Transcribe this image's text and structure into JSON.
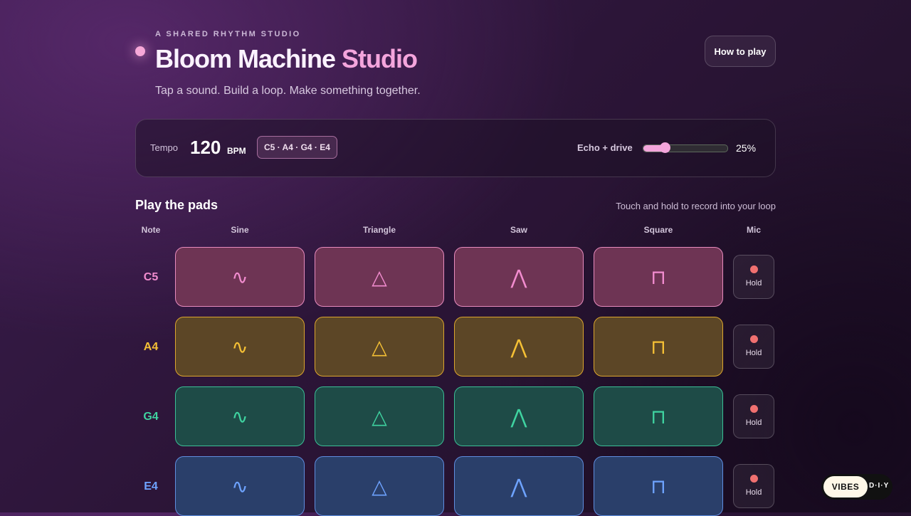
{
  "header": {
    "kicker": "A SHARED RHYTHM STUDIO",
    "title_main": "Bloom Machine",
    "title_accent": "Studio",
    "subtitle": "Tap a sound. Build a loop. Make something together.",
    "how_to_label": "How to play"
  },
  "controls": {
    "tempo_label": "Tempo",
    "tempo_value": "120",
    "tempo_unit": "BPM",
    "notes_chip": "C5 · A4 · G4 · E4",
    "echo_label": "Echo + drive",
    "echo_value": 25,
    "echo_display": "25%"
  },
  "pads": {
    "title": "Play the pads",
    "hint": "Touch and hold to record into your loop",
    "headers": {
      "note": "Note",
      "sine": "Sine",
      "triangle": "Triangle",
      "saw": "Saw",
      "square": "Square",
      "mic": "Mic"
    },
    "rows": [
      {
        "note": "C5",
        "color": "#f28ccf"
      },
      {
        "note": "A4",
        "color": "#f5c035"
      },
      {
        "note": "G4",
        "color": "#3fd3a0"
      },
      {
        "note": "E4",
        "color": "#6ea3ff"
      }
    ],
    "wave_icons": {
      "sine": "∿",
      "triangle": "△",
      "saw": "⋀",
      "square": "⊓"
    },
    "hold_label": "Hold"
  },
  "badge": {
    "label": "VIBES",
    "suffix": "D·I·Y"
  }
}
